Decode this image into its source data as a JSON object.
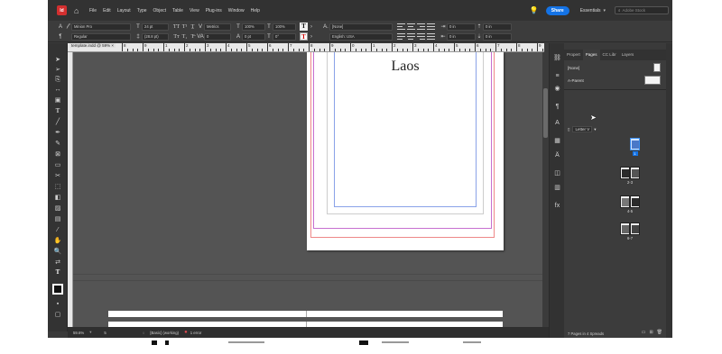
{
  "menubar": {
    "logo": "Id",
    "menus": [
      "File",
      "Edit",
      "Layout",
      "Type",
      "Object",
      "Table",
      "View",
      "Plug-ins",
      "Window",
      "Help"
    ],
    "share_label": "Share",
    "workspace": "Essentials",
    "search_placeholder": "Adobe Stock"
  },
  "control": {
    "font_family": "Minion Pro",
    "font_style": "Regular",
    "font_size": "24 pt",
    "leading": "(28.8 pt)",
    "kerning": "Metrics",
    "tracking": "0",
    "h_scale": "100%",
    "v_scale": "100%",
    "baseline": "0 pt",
    "skew": "0°",
    "char_style": "[None]",
    "language": "English: USA",
    "indent_left": "0 in",
    "indent_right": "0 in",
    "space_before": "0 in",
    "space_after": "0 in"
  },
  "document": {
    "tab_label": "template.indd @ 59%",
    "page_heading": "Laos"
  },
  "ruler": {
    "labels": [
      "8",
      "9",
      "1",
      "2",
      "3",
      "4",
      "5",
      "6",
      "7",
      "8",
      "9",
      "0",
      "1",
      "2",
      "3",
      "4",
      "5",
      "6",
      "7",
      "8",
      "9",
      "0"
    ]
  },
  "status": {
    "zoom": "59.6%",
    "page": "5",
    "preflight_profile": "[Basic] (working)",
    "errors": "1 error"
  },
  "panel": {
    "tabs": [
      "Propert",
      "Pages",
      "CC Libr",
      "Layers"
    ],
    "active_tab": "Pages",
    "masters": [
      "[None]",
      "A-Parent"
    ],
    "page_size": "Letter V",
    "spread_labels": [
      "1",
      "2-3",
      "4-5",
      "6-7"
    ],
    "footer_text": "7 Pages in 4 Spreads"
  },
  "colors": {
    "accent": "#1473e6",
    "error": "#e34850",
    "app_logo": "#d32f2f"
  }
}
